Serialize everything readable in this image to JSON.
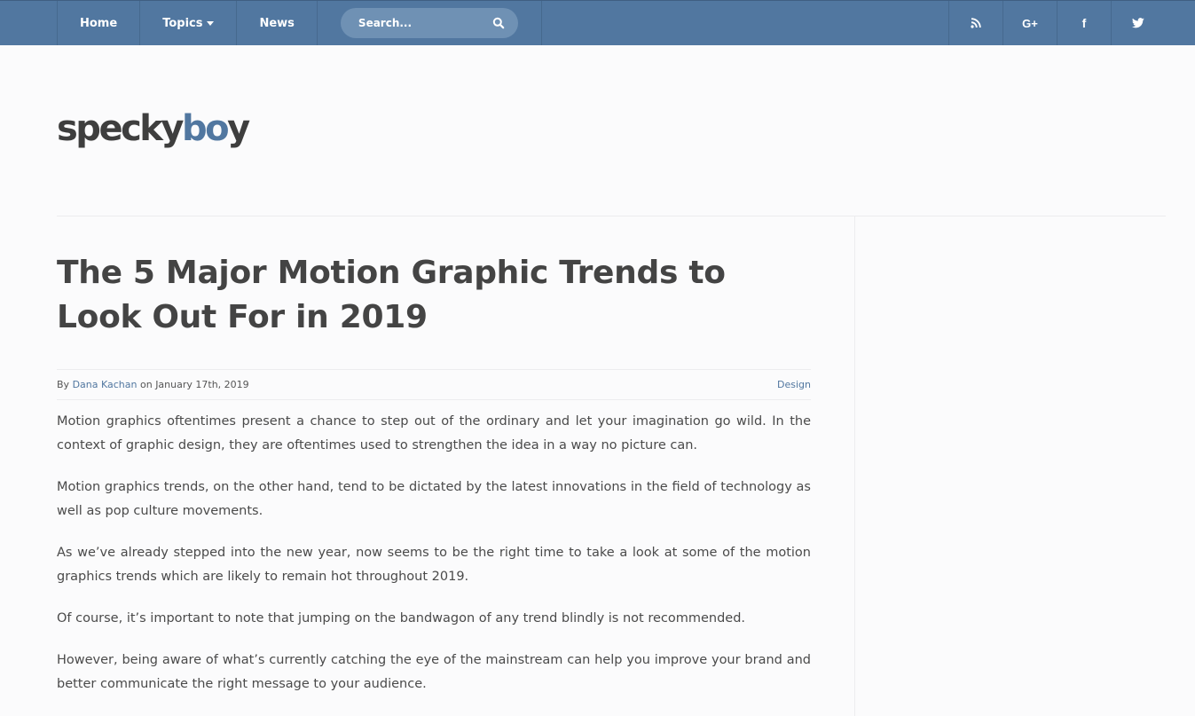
{
  "nav": {
    "items": [
      {
        "label": "Home"
      },
      {
        "label": "Topics"
      },
      {
        "label": "News"
      }
    ],
    "search_placeholder": "Search...",
    "social": {
      "gplus_label": "G+",
      "facebook_label": "f"
    },
    "colors": {
      "bar": "#5177a0",
      "search_bg": "#6f91b4"
    }
  },
  "logo": {
    "part1": "specky",
    "part2": "bo",
    "part3": "y"
  },
  "article": {
    "title": "The 5 Major Motion Graphic Trends to Look Out For in 2019",
    "meta": {
      "by": "By",
      "author": "Dana Kachan",
      "on": "on",
      "date": "January 17th, 2019",
      "category": "Design"
    },
    "paragraphs": [
      "Motion graphics oftentimes present a chance to step out of the ordinary and let your imagination go wild. In the context of graphic design, they are oftentimes used to strengthen the idea in a way no picture can.",
      "Motion graphics trends, on the other hand, tend to be dictated by the latest innovations in the field of technology as well as pop culture movements.",
      "As we’ve already stepped into the new year, now seems to be the right time to take a look at some of the motion graphics trends which are likely to remain hot throughout 2019.",
      "Of course, it’s important to note that jumping on the bandwagon of any trend blindly is not recommended.",
      "However, being aware of what’s currently catching the eye of the mainstream can help you improve your brand and better communicate the right message to your audience."
    ]
  }
}
